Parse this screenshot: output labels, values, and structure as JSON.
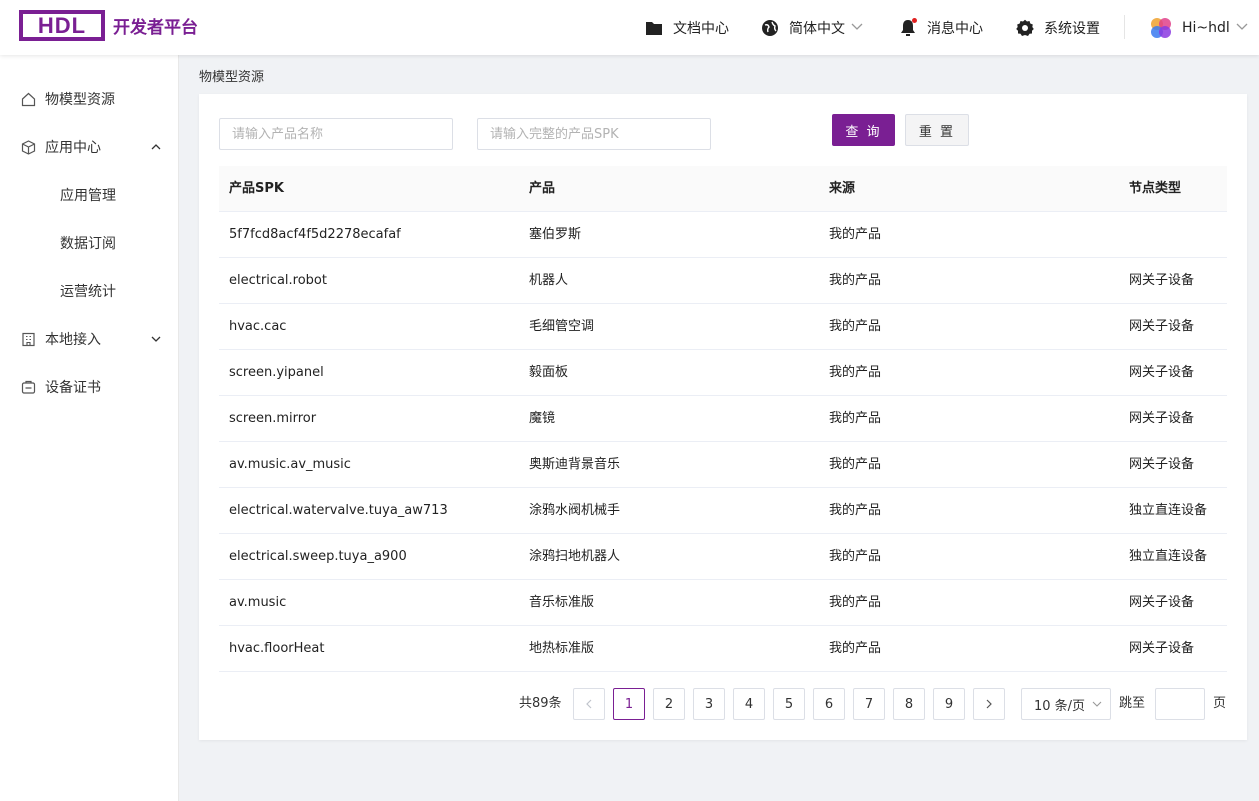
{
  "header": {
    "logo_text": "HDL",
    "brand_title": "开发者平台",
    "nav": {
      "docs": "文档中心",
      "language": "简体中文",
      "messages": "消息中心",
      "settings": "系统设置",
      "user": "Hi~hdl"
    },
    "brand_color": "#7a1f93",
    "notification_dot_color": "#e02020"
  },
  "sidebar": {
    "items": [
      {
        "label": "物模型资源",
        "icon": "cube-outline-icon"
      },
      {
        "label": "应用中心",
        "icon": "package-icon",
        "expanded": true
      },
      {
        "label": "应用管理"
      },
      {
        "label": "数据订阅"
      },
      {
        "label": "运营统计"
      },
      {
        "label": "本地接入",
        "icon": "building-icon",
        "expanded": false
      },
      {
        "label": "设备证书",
        "icon": "certificate-icon"
      }
    ]
  },
  "breadcrumb": "物模型资源",
  "search": {
    "name_placeholder": "请输入产品名称",
    "spk_placeholder": "请输入完整的产品SPK",
    "query_label": "查 询",
    "reset_label": "重 置"
  },
  "table": {
    "columns": [
      "产品SPK",
      "产品",
      "来源",
      "节点类型"
    ],
    "rows": [
      [
        "5f7fcd8acf4f5d2278ecafaf",
        "塞伯罗斯",
        "我的产品",
        ""
      ],
      [
        "electrical.robot",
        "机器人",
        "我的产品",
        "网关子设备"
      ],
      [
        "hvac.cac",
        "毛细管空调",
        "我的产品",
        "网关子设备"
      ],
      [
        "screen.yipanel",
        "毅面板",
        "我的产品",
        "网关子设备"
      ],
      [
        "screen.mirror",
        "魔镜",
        "我的产品",
        "网关子设备"
      ],
      [
        "av.music.av_music",
        "奥斯迪背景音乐",
        "我的产品",
        "网关子设备"
      ],
      [
        "electrical.watervalve.tuya_aw713",
        "涂鸦水阀机械手",
        "我的产品",
        "独立直连设备"
      ],
      [
        "electrical.sweep.tuya_a900",
        "涂鸦扫地机器人",
        "我的产品",
        "独立直连设备"
      ],
      [
        "av.music",
        "音乐标准版",
        "我的产品",
        "网关子设备"
      ],
      [
        "hvac.floorHeat",
        "地热标准版",
        "我的产品",
        "网关子设备"
      ]
    ]
  },
  "pagination": {
    "total": "共89条",
    "prev": "<",
    "next": ">",
    "pages": [
      "1",
      "2",
      "3",
      "4",
      "5",
      "6",
      "7",
      "8",
      "9"
    ],
    "current": "1",
    "page_size": "10 条/页",
    "jump_label": "跳至",
    "page_unit": "页"
  }
}
